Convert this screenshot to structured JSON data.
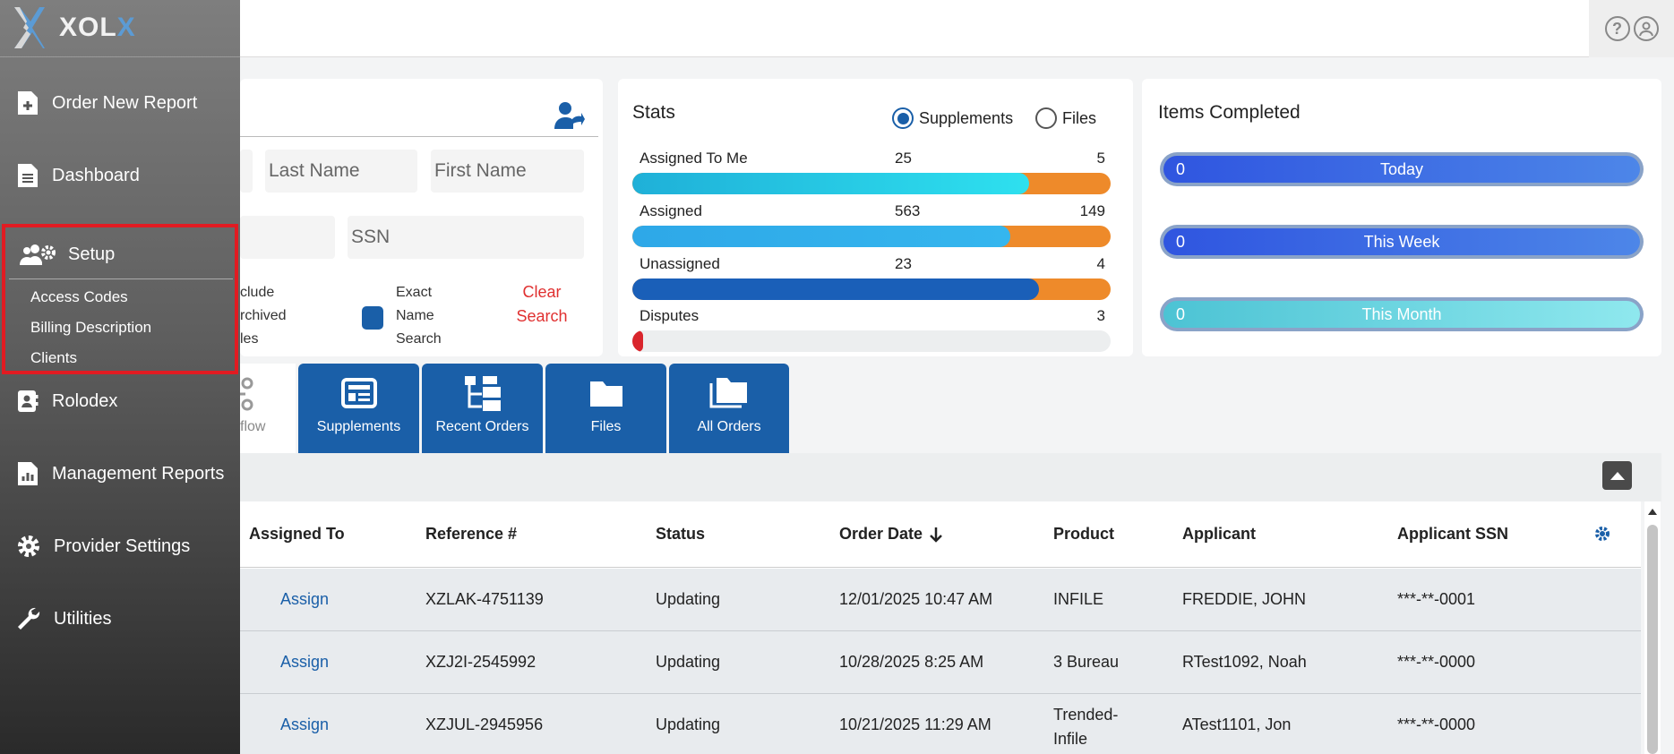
{
  "app": {
    "logo_a": "XOL",
    "logo_b": "X"
  },
  "sidebar": {
    "items": [
      {
        "label": "Order New Report"
      },
      {
        "label": "Dashboard"
      },
      {
        "label": "Setup"
      },
      {
        "label": "Rolodex"
      },
      {
        "label": "Management Reports"
      },
      {
        "label": "Provider Settings"
      },
      {
        "label": "Utilities"
      }
    ],
    "setup_sub": [
      "Access Codes",
      "Billing Description",
      "Clients"
    ]
  },
  "search": {
    "last_name_placeholder": "Last Name",
    "first_name_placeholder": "First Name",
    "ssn_placeholder": "SSN",
    "include_archived": [
      "clude",
      "rchived",
      "les"
    ],
    "exact_name": [
      "Exact",
      "Name",
      "Search"
    ],
    "clear": [
      "Clear",
      "Search"
    ]
  },
  "stats": {
    "title": "Stats",
    "radio_supplements": "Supplements",
    "radio_files": "Files",
    "rows": [
      {
        "label": "Assigned To Me",
        "a": "25",
        "b": "5",
        "fill": 0.83,
        "color": "linear-gradient(90deg,#1fb0d8,#2ee0ef)"
      },
      {
        "label": "Assigned",
        "a": "563",
        "b": "149",
        "fill": 0.79,
        "color": "linear-gradient(90deg,#2ea8e8,#35b6ee)"
      },
      {
        "label": "Unassigned",
        "a": "23",
        "b": "4",
        "fill": 0.85,
        "color": "#1a5fb8"
      },
      {
        "label": "Disputes",
        "a": "",
        "b": "3",
        "fill": 0.02,
        "color": "#d9252c"
      }
    ]
  },
  "items_completed": {
    "title": "Items Completed",
    "pills": [
      {
        "num": "0",
        "label": "Today"
      },
      {
        "num": "0",
        "label": "This Week"
      },
      {
        "num": "0",
        "label": "This Month"
      }
    ]
  },
  "tabs": {
    "workflow_partial": "flow",
    "items": [
      "Supplements",
      "Recent Orders",
      "Files",
      "All Orders"
    ]
  },
  "table": {
    "headers": [
      "Assigned To",
      "Reference #",
      "Status",
      "Order Date",
      "Product",
      "Applicant",
      "Applicant SSN"
    ],
    "rows": [
      {
        "assign": "Assign",
        "ref": "XZLAK-4751139",
        "status": "Updating",
        "date": "12/01/2025 10:47 AM",
        "product": [
          "INFILE"
        ],
        "applicant": "FREDDIE, JOHN",
        "ssn": "***-**-0001"
      },
      {
        "assign": "Assign",
        "ref": "XZJ2I-2545992",
        "status": "Updating",
        "date": "10/28/2025 8:25 AM",
        "product": [
          "3 Bureau"
        ],
        "applicant": "RTest1092, Noah",
        "ssn": "***-**-0000"
      },
      {
        "assign": "Assign",
        "ref": "XZJUL-2945956",
        "status": "Updating",
        "date": "10/21/2025 11:29 AM",
        "product": [
          "Trended-",
          "Infile"
        ],
        "applicant": "ATest1101, Jon",
        "ssn": "***-**-0000"
      }
    ]
  }
}
